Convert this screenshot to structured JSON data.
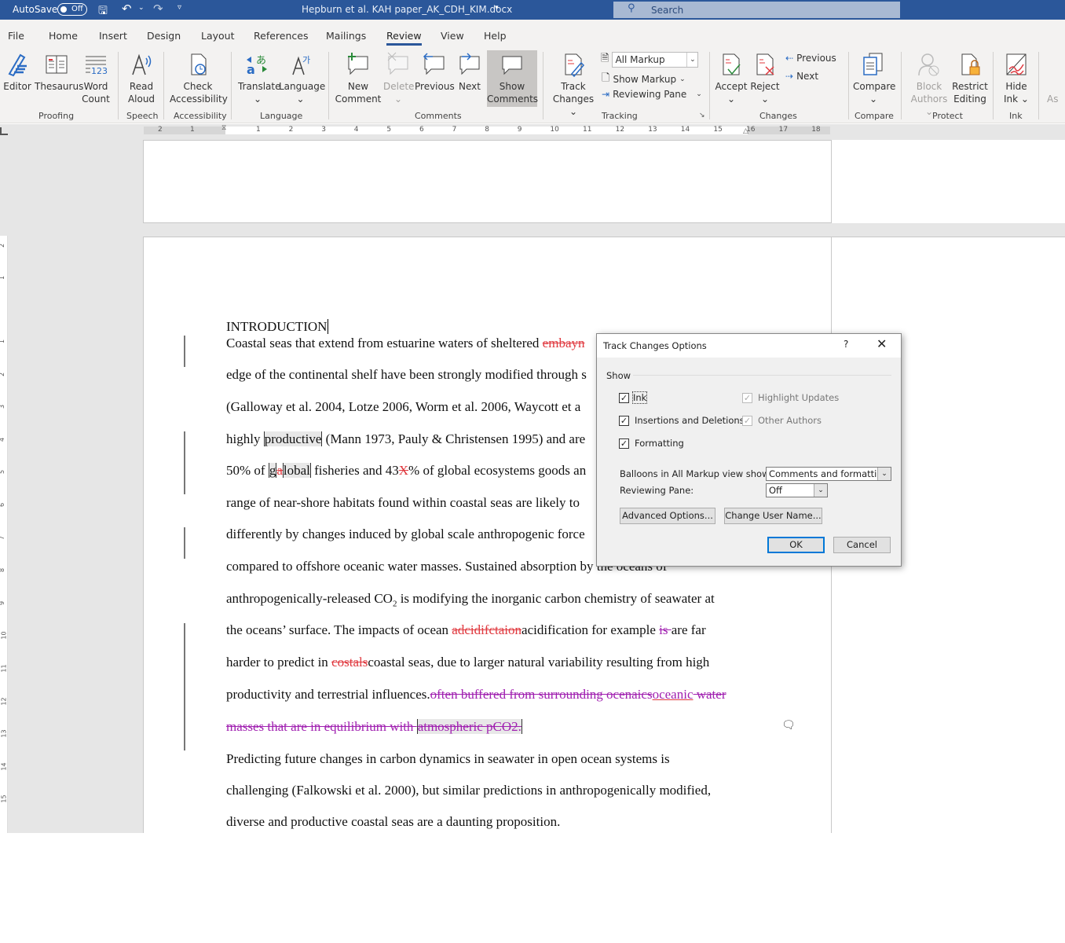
{
  "titlebar": {
    "autosave_label": "AutoSave",
    "autosave_state": "Off",
    "doc_title": "Hepburn et al. KAH paper_AK_CDH_KIM.docx",
    "search_placeholder": "Search",
    "color": "#2b579a"
  },
  "menu": {
    "tabs": [
      "File",
      "Home",
      "Insert",
      "Design",
      "Layout",
      "References",
      "Mailings",
      "Review",
      "View",
      "Help"
    ],
    "active": "Review"
  },
  "ribbon": {
    "proofing": {
      "label": "Proofing",
      "editor": "Editor",
      "thesaurus": "Thesaurus",
      "word_count": [
        "Word",
        "Count"
      ]
    },
    "speech": {
      "label": "Speech",
      "read_aloud": [
        "Read",
        "Aloud"
      ]
    },
    "accessibility": {
      "label": "Accessibility",
      "check": [
        "Check",
        "Accessibility"
      ]
    },
    "language": {
      "label": "Language",
      "translate": "Translate",
      "language": "Language"
    },
    "comments": {
      "label": "Comments",
      "new": [
        "New",
        "Comment"
      ],
      "delete": "Delete",
      "previous": "Previous",
      "next": "Next",
      "show": [
        "Show",
        "Comments"
      ]
    },
    "tracking": {
      "label": "Tracking",
      "track_changes": [
        "Track",
        "Changes"
      ],
      "markup_select": "All Markup",
      "show_markup": "Show Markup",
      "reviewing_pane": "Reviewing Pane"
    },
    "changes": {
      "label": "Changes",
      "accept": "Accept",
      "reject": "Reject",
      "previous": "Previous",
      "next": "Next"
    },
    "compare": {
      "label": "Compare",
      "compare": "Compare"
    },
    "protect": {
      "label": "Protect",
      "block_authors": [
        "Block",
        "Authors"
      ],
      "restrict_editing": [
        "Restrict",
        "Editing"
      ]
    },
    "ink": {
      "label": "Ink",
      "hide_ink": [
        "Hide",
        "Ink"
      ],
      "overflow": "As"
    }
  },
  "ruler": {
    "numbers": [
      "2",
      "1",
      "1",
      "2",
      "3",
      "4",
      "5",
      "6",
      "7",
      "8",
      "9",
      "10",
      "11",
      "12",
      "13",
      "14",
      "15",
      "16",
      "17",
      "18"
    ],
    "vertical": [
      "2",
      "1",
      "1",
      "2",
      "3",
      "4",
      "5",
      "6",
      "7",
      "8",
      "9",
      "10",
      "11",
      "12",
      "13",
      "14",
      "15"
    ]
  },
  "document": {
    "heading": "INTRODUCTION",
    "lines": [
      [
        {
          "t": "Coastal seas that extend from estuarine waters of sheltered "
        },
        {
          "t": "embayn",
          "s": "del-red"
        }
      ],
      [
        {
          "t": "edge of the continental shelf have been strongly modified through s"
        }
      ],
      [
        {
          "t": "(Galloway et al. 2004, Lotze 2006, Worm et al. 2006, Waycott et a"
        }
      ],
      [
        {
          "t": "highly "
        },
        {
          "t": "productive",
          "s": "hl"
        },
        {
          "t": " (Mann 1973, Pauly & Christensen 1995) and are"
        }
      ],
      [
        {
          "t": "50% of "
        },
        {
          "t": "g",
          "s": "hl"
        },
        {
          "t": "a",
          "s": "del-red"
        },
        {
          "t": "lobal",
          "s": "hl"
        },
        {
          "t": " fisheries and 43"
        },
        {
          "t": "X",
          "s": "del-red"
        },
        {
          "t": "% of global ecosystems goods an"
        }
      ],
      [
        {
          "t": "range of near-shore habitats found within coastal seas are likely to"
        }
      ],
      [
        {
          "t": "differently by changes induced by global scale anthropogenic force"
        }
      ],
      [
        {
          "t": "compared to offshore oceanic water masses.  Sustained absorption by the oceans of"
        }
      ],
      [
        {
          "t": "anthropogenically-released CO"
        },
        {
          "t": "2",
          "s": "sub"
        },
        {
          "t": " is modifying the inorganic carbon chemistry of seawater at"
        }
      ],
      [
        {
          "t": "the oceans’ surface.  The impacts of ocean "
        },
        {
          "t": "adcidifctaion",
          "s": "del-red"
        },
        {
          "t": "acidification for example "
        },
        {
          "t": "is ",
          "s": "del-purple"
        },
        {
          "t": "are far"
        }
      ],
      [
        {
          "t": "harder to predict in "
        },
        {
          "t": "costals",
          "s": "del-red"
        },
        {
          "t": "coastal seas, due to larger natural variability resulting from high"
        }
      ],
      [
        {
          "t": "productivity and terrestrial influences."
        },
        {
          "t": "often buffered from surrounding ocenaics",
          "s": "del-purple"
        },
        {
          "t": "oceanic",
          "s": "ins-purple"
        },
        {
          "t": " water",
          "s": "del-purple"
        }
      ],
      [
        {
          "t": "masses that are in equilibrium with ",
          "s": "del-purple"
        },
        {
          "t": "atmospheric pCO2.",
          "s": "hl-del"
        }
      ],
      [
        {
          "t": "Predicting future changes in carbon dynamics in seawater in open ocean systems is"
        }
      ],
      [
        {
          "t": "challenging (Falkowski et al. 2000), but similar predictions in anthropogenically modified,"
        }
      ],
      [
        {
          "t": "diverse and productive coastal seas are a daunting proposition."
        }
      ]
    ]
  },
  "dialog": {
    "title": "Track Changes Options",
    "help": "?",
    "show_label": "Show",
    "checks": [
      {
        "label": "Ink",
        "checked": true,
        "enabled": true
      },
      {
        "label": "Insertions and Deletions",
        "checked": true,
        "enabled": true
      },
      {
        "label": "Formatting",
        "checked": true,
        "enabled": true
      },
      {
        "label": "Highlight Updates",
        "checked": true,
        "enabled": false
      },
      {
        "label": "Other Authors",
        "checked": true,
        "enabled": false
      }
    ],
    "balloons_label": "Balloons in All Markup view show:",
    "balloons_value": "Comments and formatting",
    "pane_label": "Reviewing Pane:",
    "pane_value": "Off",
    "advanced": "Advanced Options...",
    "change_user": "Change User Name...",
    "ok": "OK",
    "cancel": "Cancel"
  }
}
